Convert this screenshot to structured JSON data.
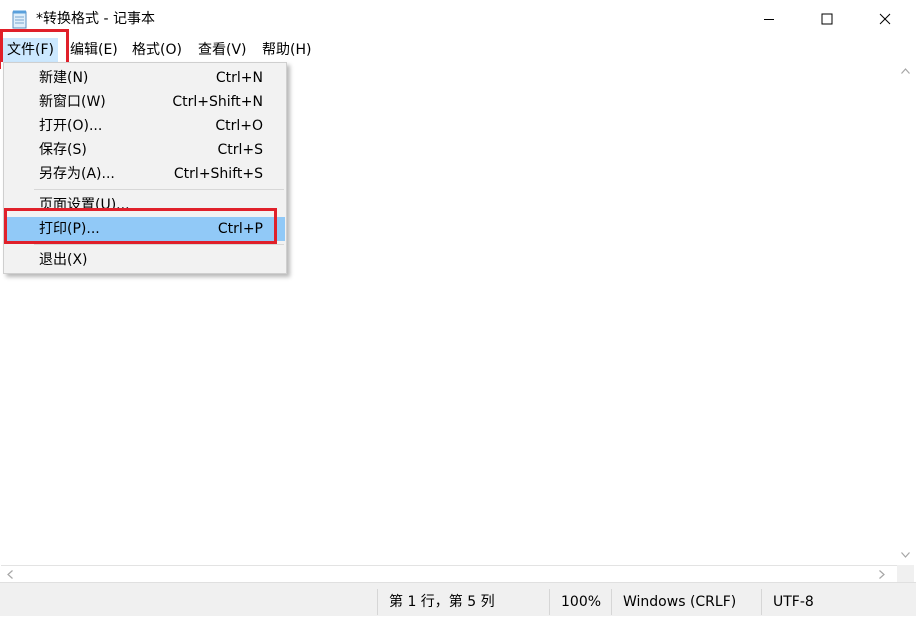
{
  "window": {
    "title": "*转换格式 - 记事本",
    "icon": "notepad-icon",
    "controls": [
      "minimize-icon",
      "maximize-icon",
      "close-icon"
    ]
  },
  "menubar": [
    {
      "label": "文件(F)",
      "active": true
    },
    {
      "label": "编辑(E)"
    },
    {
      "label": "格式(O)"
    },
    {
      "label": "查看(V)"
    },
    {
      "label": "帮助(H)"
    }
  ],
  "file_menu": [
    {
      "label": "新建(N)",
      "shortcut": "Ctrl+N"
    },
    {
      "label": "新窗口(W)",
      "shortcut": "Ctrl+Shift+N"
    },
    {
      "label": "打开(O)...",
      "shortcut": "Ctrl+O"
    },
    {
      "label": "保存(S)",
      "shortcut": "Ctrl+S"
    },
    {
      "label": "另存为(A)...",
      "shortcut": "Ctrl+Shift+S"
    },
    {
      "label": "页面设置(U)...",
      "shortcut": ""
    },
    {
      "label": "打印(P)...",
      "shortcut": "Ctrl+P",
      "highlighted": true
    },
    {
      "label": "退出(X)",
      "shortcut": ""
    }
  ],
  "statusbar": {
    "position": "第 1 行，第 5 列",
    "zoom": "100%",
    "line_ending": "Windows (CRLF)",
    "encoding": "UTF-8"
  },
  "colors": {
    "highlight_box": "#e0202a",
    "menu_hover": "#91c9f7",
    "menubar_active": "#cce8ff"
  }
}
